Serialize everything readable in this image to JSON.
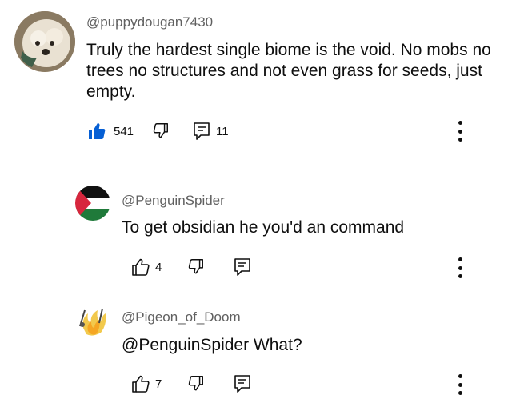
{
  "comments": [
    {
      "handle": "@puppydougan7430",
      "text": "Truly the hardest single biome is the void. No mobs no trees no structures and not even grass for seeds, just empty.",
      "likes": "541",
      "replies": "11",
      "liked": true
    },
    {
      "handle": "@PenguinSpider",
      "text": "To get obsidian he you'd an command",
      "likes": "4",
      "liked": false
    },
    {
      "handle": "@Pigeon_of_Doom",
      "text": "@PenguinSpider What?",
      "likes": "7",
      "liked": false
    }
  ],
  "icons": {
    "like": "thumbs-up-icon",
    "dislike": "thumbs-down-icon",
    "reply": "reply-icon",
    "more": "more-vertical-icon"
  },
  "colors": {
    "accent_blue": "#065fd4",
    "text_primary": "#0f0f0f",
    "text_secondary": "#606060"
  }
}
